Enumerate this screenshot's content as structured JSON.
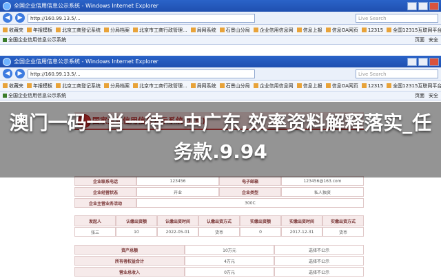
{
  "window1": {
    "title": "全国企业信用信息公示系统 - Windows Internet Explorer",
    "url": "http://160.99.13.5/...",
    "search_placeholder": "Live Search",
    "favorites": [
      "收藏夹",
      "年报模板",
      "北京工商登记系统",
      "分局档案",
      "北京市工商行政管理...",
      "局网系统",
      "石景山分局",
      "企业信用信息网",
      "信息上报",
      "信息OA网页",
      "12315",
      "全国12315互联网平台"
    ],
    "tab": "全国企业信用信息公示系统",
    "page_label": "页面",
    "safety_label": "安全"
  },
  "window2": {
    "title": "全国企业信用信息公示系统 - Windows Internet Explorer",
    "url": "http://160.99.13.5/...",
    "search_placeholder": "Live Search",
    "favorites": [
      "收藏夹",
      "年报模板",
      "北京工商登记系统",
      "分局档案",
      "北京市工商行政管理...",
      "局网系统",
      "石景山分局",
      "企业信用信息网",
      "信息上报",
      "信息OA网页",
      "12315",
      "全国12315互联网平台"
    ],
    "tab": "全国企业信用信息公示系统",
    "page_label": "页面",
    "safety_label": "安全"
  },
  "document": {
    "header": "国家企业信用信息公示系统(北京)",
    "rows": [
      [
        "企业联系电话",
        "123456",
        "电子邮箱",
        "123456@163.com"
      ],
      [
        "企业经营状态",
        "开业",
        "企业类型",
        "私人独资"
      ],
      [
        "企业主营业务活动",
        "300C",
        "",
        ""
      ]
    ],
    "table_headers": [
      "发起人",
      "认缴出资额",
      "认缴出资时间",
      "认缴出资方式",
      "实缴出资额",
      "实缴出资时间",
      "实缴出资方式"
    ],
    "table_row": [
      "张三",
      "10",
      "2022-05-01",
      "货币",
      "0",
      "2017-12-31",
      "货币"
    ],
    "finance_rows": [
      [
        "资产总额",
        "10万元",
        "选择不公示"
      ],
      [
        "所有者权益合计",
        "4万元",
        "选择不公示"
      ],
      [
        "营业总收入",
        "0万元",
        "选择不公示"
      ]
    ]
  },
  "headline": "澳门一码一肖一待一中广东,效率资料解释落实_任务款.9.94"
}
